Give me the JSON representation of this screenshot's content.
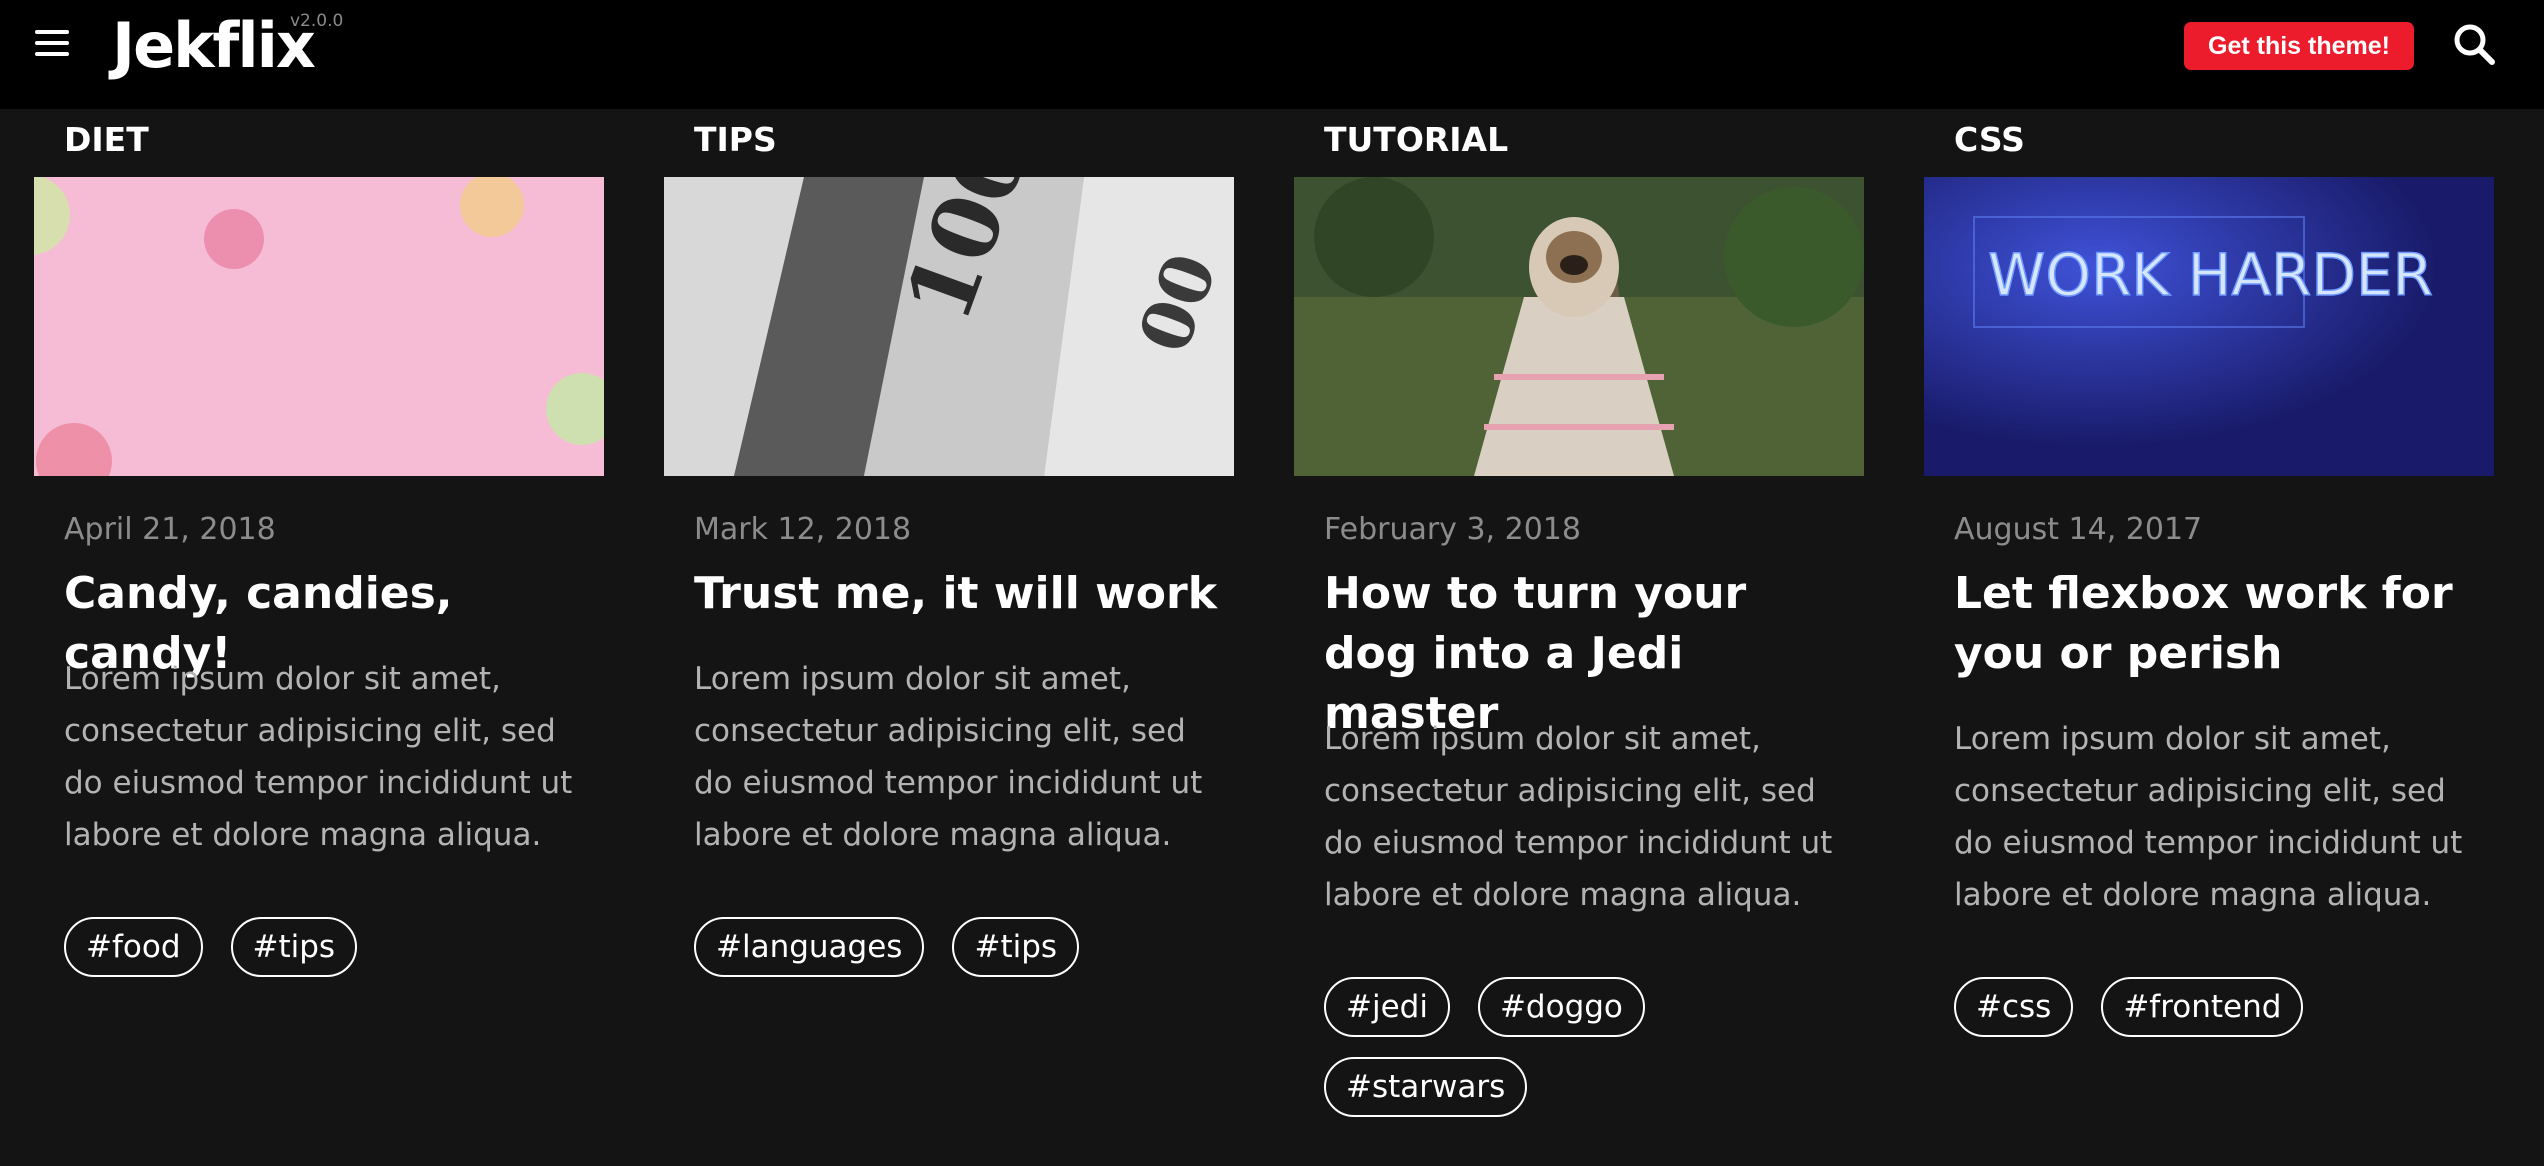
{
  "header": {
    "logo": "Jekflix",
    "version": "v2.0.0",
    "cta_label": "Get this theme!"
  },
  "icons": {
    "menu": "hamburger-menu-icon",
    "search": "search-icon"
  },
  "colors": {
    "background": "#141414",
    "header": "#000000",
    "accent": "#ec1c2c",
    "muted_text": "#8c8c8c",
    "body_text": "#b3b3b3"
  },
  "posts": [
    {
      "category": "DIET",
      "date": "April 21, 2018",
      "title": "Candy, candies, candy!",
      "excerpt": "Lorem ipsum dolor sit amet, consectetur adipisicing elit, sed do eiusmod tempor incididunt ut labore et dolore magna aliqua.",
      "tags": [
        "#food",
        "#tips"
      ]
    },
    {
      "category": "TIPS",
      "date": "Mark 12, 2018",
      "title": "Trust me, it will work",
      "excerpt": "Lorem ipsum dolor sit amet, consectetur adipisicing elit, sed do eiusmod tempor incididunt ut labore et dolore magna aliqua.",
      "tags": [
        "#languages",
        "#tips"
      ]
    },
    {
      "category": "TUTORIAL",
      "date": "February 3, 2018",
      "title": "How to turn your dog into a Jedi master",
      "excerpt": "Lorem ipsum dolor sit amet, consectetur adipisicing elit, sed do eiusmod tempor incididunt ut labore et dolore magna aliqua.",
      "tags": [
        "#jedi",
        "#doggo",
        "#starwars"
      ]
    },
    {
      "category": "CSS",
      "date": "August 14, 2017",
      "title": "Let flexbox work for you or perish",
      "excerpt": "Lorem ipsum dolor sit amet, consectetur adipisicing elit, sed do eiusmod tempor incididunt ut labore et dolore magna aliqua.",
      "tags": [
        "#css",
        "#frontend"
      ]
    }
  ],
  "thumbnail_subjects": [
    "pink-macarons",
    "dollar-bills",
    "pug-in-blanket",
    "neon-work-harder-sign"
  ],
  "neon_sign_text": "WORK HARDER"
}
